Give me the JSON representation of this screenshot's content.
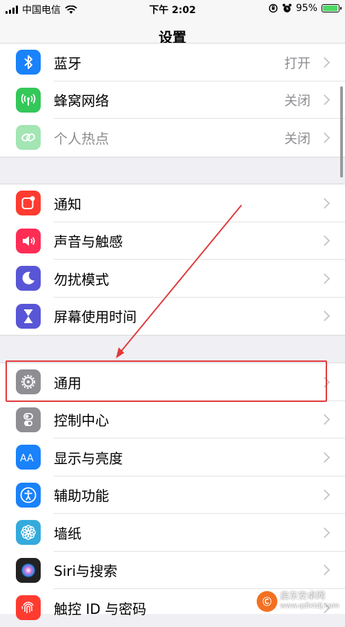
{
  "status_bar": {
    "carrier": "中国电信",
    "time": "下午 2:02",
    "battery": "95%",
    "battery_level": 0.95
  },
  "nav": {
    "title": "设置"
  },
  "groups": [
    {
      "items": [
        {
          "label": "蓝牙",
          "value": "打开",
          "icon": "bluetooth-icon",
          "color": "#1a82fb"
        },
        {
          "label": "蜂窝网络",
          "value": "关闭",
          "icon": "cellular-antenna-icon",
          "color": "#34c759"
        },
        {
          "label": "个人热点",
          "value": "关闭",
          "icon": "hotspot-link-icon",
          "color": "#34c759",
          "disabled": true
        }
      ]
    },
    {
      "items": [
        {
          "label": "通知",
          "icon": "notifications-icon",
          "color": "#ff3b30"
        },
        {
          "label": "声音与触感",
          "icon": "speaker-icon",
          "color": "#ff2d55"
        },
        {
          "label": "勿扰模式",
          "icon": "moon-icon",
          "color": "#5856d6"
        },
        {
          "label": "屏幕使用时间",
          "icon": "hourglass-icon",
          "color": "#5856d6"
        }
      ]
    },
    {
      "items": [
        {
          "label": "通用",
          "icon": "gear-icon",
          "color": "#8e8e93"
        },
        {
          "label": "控制中心",
          "icon": "toggles-icon",
          "color": "#8e8e93"
        },
        {
          "label": "显示与亮度",
          "icon": "text-size-icon",
          "color": "#1a82fb"
        },
        {
          "label": "辅助功能",
          "icon": "accessibility-icon",
          "color": "#1a82fb"
        },
        {
          "label": "墙纸",
          "icon": "flower-icon",
          "color": "#34aadc"
        },
        {
          "label": "Siri与搜索",
          "icon": "siri-icon",
          "color": "#222222"
        },
        {
          "label": "触控 ID 与密码",
          "icon": "fingerprint-icon",
          "color": "#ff3b30"
        }
      ]
    }
  ],
  "annotation": {
    "highlight_color": "#e03a3a"
  },
  "watermark": {
    "line1": "启东安卓网",
    "line2": "www.qdlxtdj.com",
    "badge": "Ⓒ"
  }
}
